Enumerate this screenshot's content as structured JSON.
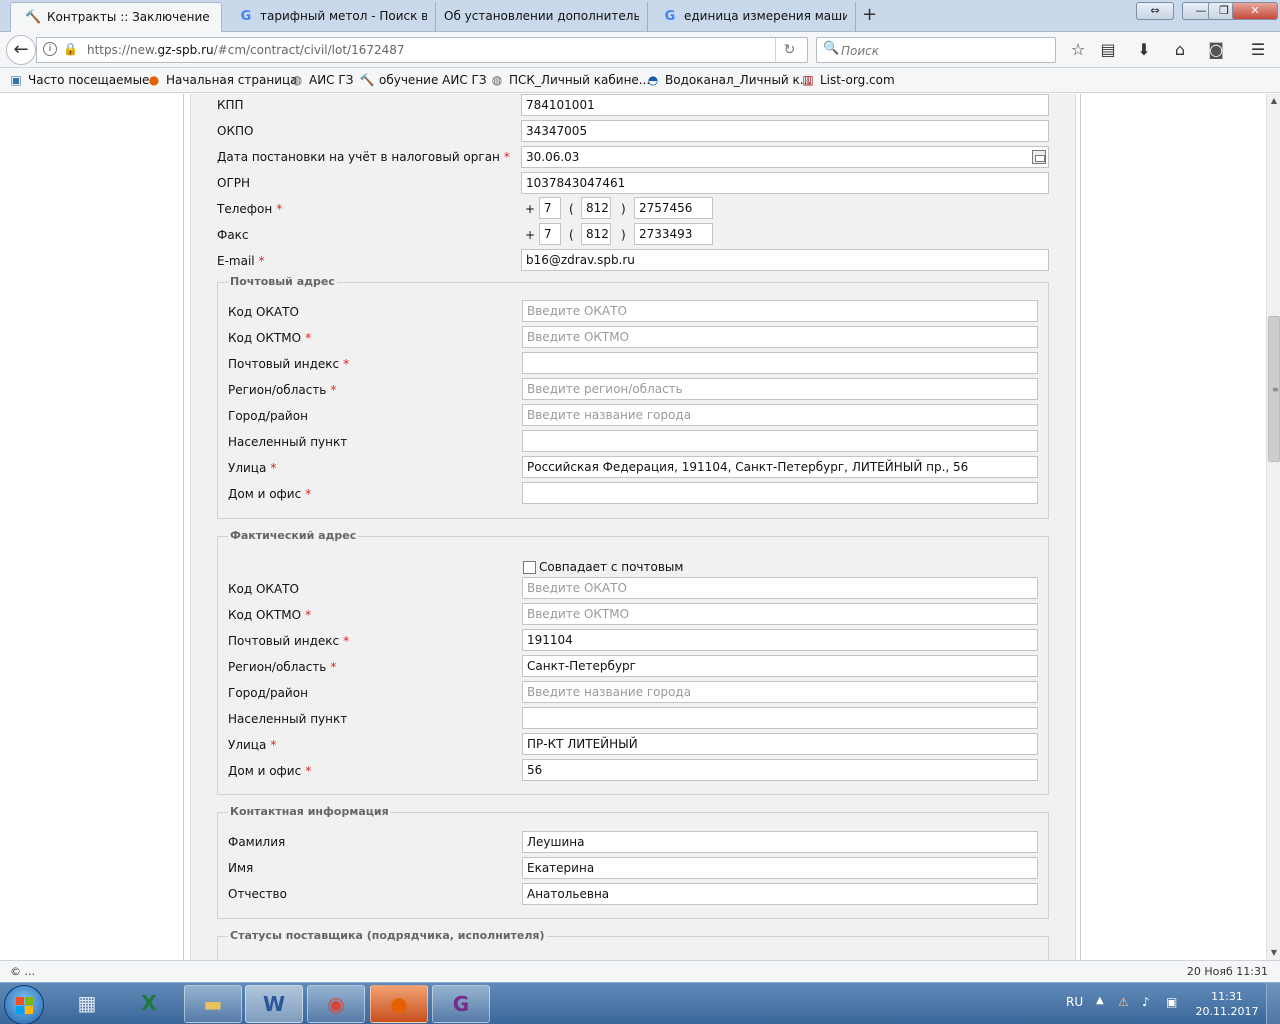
{
  "browser": {
    "tabs": [
      {
        "label": "Контракты :: Заключение к",
        "icon": "hammer-icon"
      },
      {
        "label": "тарифный метол - Поиск в",
        "icon": "google-icon"
      },
      {
        "label": "Об установлении дополнительн",
        "icon": ""
      },
      {
        "label": "единица измерения машин",
        "icon": "google-icon"
      }
    ],
    "new_tab": "+",
    "window_controls": {
      "restore_alt": "⇔",
      "minimize": "—",
      "maximize": "❐",
      "close": "✕"
    },
    "url_host": "https://new.",
    "url_domain": "gz-spb.ru",
    "url_path": "/#cm/contract/civil/lot/1672487",
    "search_placeholder": "Поиск",
    "bookmarks": [
      {
        "label": "Часто посещаемые",
        "icon": "bookmark-icon"
      },
      {
        "label": "Начальная страница",
        "icon": "firefox-icon"
      },
      {
        "label": "АИС ГЗ",
        "icon": "globe-icon"
      },
      {
        "label": "обучение АИС ГЗ",
        "icon": "hammer-icon"
      },
      {
        "label": "ПСК_Личный кабине...",
        "icon": "globe-icon"
      },
      {
        "label": "Водоканал_Личный к...",
        "icon": "water-icon"
      },
      {
        "label": "List-org.com",
        "icon": "list-org-icon"
      }
    ]
  },
  "form": {
    "kpp": {
      "label": "КПП",
      "value": "784101001"
    },
    "okpo": {
      "label": "ОКПО",
      "value": "34347005"
    },
    "reg_date": {
      "label": "Дата постановки на учёт в налоговый орган",
      "value": "30.06.03"
    },
    "ogrn": {
      "label": "ОГРН",
      "value": "1037843047461"
    },
    "phone": {
      "label": "Телефон",
      "plus": "+",
      "country": "7",
      "open_paren": "(",
      "code": "812",
      "close_paren": ")",
      "number": "2757456"
    },
    "fax": {
      "label": "Факс",
      "plus": "+",
      "country": "7",
      "open_paren": "(",
      "code": "812",
      "close_paren": ")",
      "number": "2733493"
    },
    "email": {
      "label": "E-mail",
      "value": "b16@zdrav.spb.ru"
    },
    "postal": {
      "legend": "Почтовый адрес",
      "okato": {
        "label": "Код ОКАТО",
        "value": "",
        "placeholder": "Введите ОКАТО"
      },
      "oktmo": {
        "label": "Код ОКТМО",
        "value": "",
        "placeholder": "Введите ОКТМО"
      },
      "index": {
        "label": "Почтовый индекс",
        "value": ""
      },
      "region": {
        "label": "Регион/область",
        "value": "",
        "placeholder": "Введите регион/область"
      },
      "city": {
        "label": "Город/район",
        "value": "",
        "placeholder": "Введите название города"
      },
      "locality": {
        "label": "Населенный пункт",
        "value": ""
      },
      "street": {
        "label": "Улица",
        "value": "Российская Федерация, 191104, Санкт-Петербург, ЛИТЕЙНЫЙ пр., 56"
      },
      "house": {
        "label": "Дом и офис",
        "value": ""
      }
    },
    "actual": {
      "legend": "Фактический адрес",
      "same_as_postal": "Совпадает с почтовым",
      "okato": {
        "label": "Код ОКАТО",
        "value": "",
        "placeholder": "Введите ОКАТО"
      },
      "oktmo": {
        "label": "Код ОКТМО",
        "value": "",
        "placeholder": "Введите ОКТМО"
      },
      "index": {
        "label": "Почтовый индекс",
        "value": "191104"
      },
      "region": {
        "label": "Регион/область",
        "value": "Санкт-Петербург"
      },
      "city": {
        "label": "Город/район",
        "value": "",
        "placeholder": "Введите название города"
      },
      "locality": {
        "label": "Населенный пункт",
        "value": ""
      },
      "street": {
        "label": "Улица",
        "value": "ПР-КТ ЛИТЕЙНЫЙ"
      },
      "house": {
        "label": "Дом и офис",
        "value": "56"
      }
    },
    "contact": {
      "legend": "Контактная информация",
      "last_name": {
        "label": "Фамилия",
        "value": "Леушина"
      },
      "first_name": {
        "label": "Имя",
        "value": "Екатерина"
      },
      "middle_name": {
        "label": "Отчество",
        "value": "Анатольевна"
      }
    },
    "statuses": {
      "legend": "Статусы поставщика (подрядчика, исполнителя)"
    },
    "required_mark": "*"
  },
  "statusbar": {
    "left": "© ...",
    "right": "20 Нояб 11:31"
  },
  "taskbar": {
    "apps": [
      "calculator-icon",
      "excel-icon",
      "explorer-icon",
      "word-icon",
      "chrome-icon",
      "firefox-icon",
      "pdf-icon"
    ],
    "lang": "RU",
    "time": "11:31",
    "date": "20.11.2017"
  },
  "colors": {
    "required": "#e02020",
    "placeholder": "#9a9a9a",
    "legend": "#666666",
    "taskbar": "#3c679a"
  }
}
